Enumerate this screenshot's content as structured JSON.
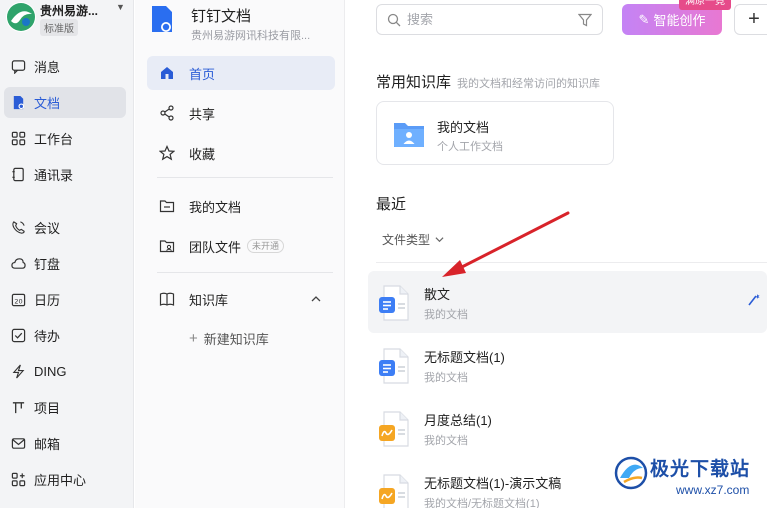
{
  "org": {
    "name": "贵州易游...",
    "badge": "标准版"
  },
  "nav": {
    "items": [
      {
        "label": "消息",
        "icon": "message-icon"
      },
      {
        "label": "文档",
        "icon": "document-icon",
        "active": true
      },
      {
        "label": "工作台",
        "icon": "workbench-icon"
      },
      {
        "label": "通讯录",
        "icon": "contacts-icon"
      },
      {
        "label": "会议",
        "icon": "meeting-icon"
      },
      {
        "label": "钉盘",
        "icon": "cloud-disk-icon"
      },
      {
        "label": "日历",
        "icon": "calendar-icon"
      },
      {
        "label": "待办",
        "icon": "todo-icon"
      },
      {
        "label": "DING",
        "icon": "ding-icon"
      },
      {
        "label": "项目",
        "icon": "project-icon"
      },
      {
        "label": "邮箱",
        "icon": "mail-icon"
      },
      {
        "label": "应用中心",
        "icon": "app-center-icon"
      }
    ]
  },
  "docs_app": {
    "title": "钉钉文档",
    "subtitle": "贵州易游网讯科技有限...",
    "menu": {
      "home": "首页",
      "share": "共享",
      "favorites": "收藏",
      "my_docs": "我的文档",
      "team_files": "团队文件",
      "team_files_tag": "未开通",
      "knowledge_base": "知识库",
      "new_kb": "新建知识库"
    }
  },
  "main": {
    "search_placeholder": "搜索",
    "ai_button": "智能创作",
    "ai_tip": "满原一竟",
    "plus_label": "+",
    "kb_section_title": "常用知识库",
    "kb_section_hint": "我的文档和经常访问的知识库",
    "kb_card": {
      "name": "我的文档",
      "desc": "个人工作文档"
    },
    "recent_title": "最近",
    "file_type_filter": "文件类型",
    "recent_docs": [
      {
        "name": "散文",
        "path": "我的文档",
        "type": "doc",
        "color": "#3d7ef5"
      },
      {
        "name": "无标题文档(1)",
        "path": "我的文档",
        "type": "doc",
        "color": "#3d7ef5"
      },
      {
        "name": "月度总结(1)",
        "path": "我的文档",
        "type": "note",
        "color": "#f5a623"
      },
      {
        "name": "无标题文档(1)-演示文稿",
        "path": "我的文档/无标题文档(1)",
        "type": "note",
        "color": "#f5a623"
      }
    ]
  },
  "watermark": {
    "name": "极光下载站",
    "url": "www.xz7.com"
  },
  "colors": {
    "accent": "#2a5cd6",
    "doc_blue": "#3d7ef5",
    "note_orange": "#f5a623",
    "arrow_red": "#d8232a"
  }
}
